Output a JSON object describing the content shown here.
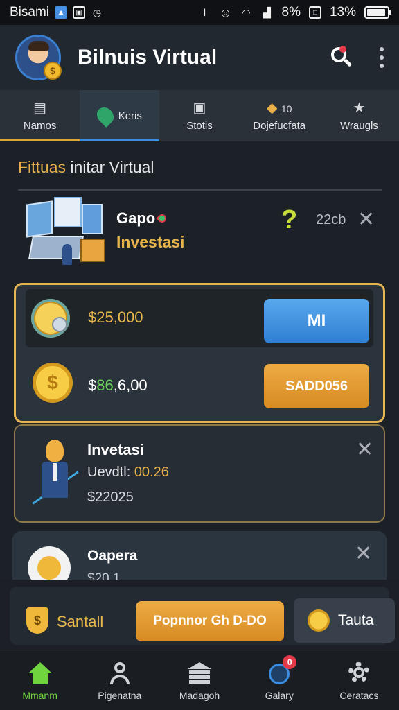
{
  "status_bar": {
    "carrier": "Bisami",
    "battery_percent": "13%",
    "signal_text": "8%"
  },
  "header": {
    "title": "Bilnuis Virtual"
  },
  "tabs": [
    {
      "label": "Namos",
      "icon": "inbox-icon"
    },
    {
      "label": "Keris",
      "icon": "location-pin-icon"
    },
    {
      "label": "Stotis",
      "icon": "chart-icon"
    },
    {
      "label": "Dojefucfata",
      "icon": "gift-icon",
      "badge": "10"
    },
    {
      "label": "Wraugls",
      "icon": "star-icon"
    }
  ],
  "section": {
    "title_accent": "Fittuas",
    "title_rest": " initar Virtual"
  },
  "feature": {
    "line1": "Gapo",
    "line2": "Investasi",
    "value": "22cb"
  },
  "gold_card": {
    "row1_amount": "$25,000",
    "row1_button": "MI",
    "row2_amount_prefix": "$",
    "row2_amount_green": "86",
    "row2_amount_suffix": ",6,00",
    "row2_button": "SADD056"
  },
  "investment_card": {
    "title": "Invetasi",
    "subtitle_label": "Uevdtl: ",
    "subtitle_value": "00.26",
    "amount": "$22025"
  },
  "card3": {
    "title": "Oapera",
    "subtitle": "$20 1..."
  },
  "action_bar": {
    "label": "Santall",
    "primary_button": "Popnnor Gh D-DO",
    "secondary_button": "Tauta"
  },
  "bottom_nav": [
    {
      "label": "Mmanm",
      "icon": "home-icon",
      "active": true
    },
    {
      "label": "Pigenatna",
      "icon": "user-icon"
    },
    {
      "label": "Madagoh",
      "icon": "bank-icon"
    },
    {
      "label": "Galary",
      "icon": "globe-icon",
      "badge": "0"
    },
    {
      "label": "Ceratacs",
      "icon": "gear-icon"
    }
  ],
  "colors": {
    "accent_gold": "#e6b452",
    "accent_blue": "#3a8de0",
    "accent_green": "#6fd43e",
    "background": "#1c2128"
  }
}
